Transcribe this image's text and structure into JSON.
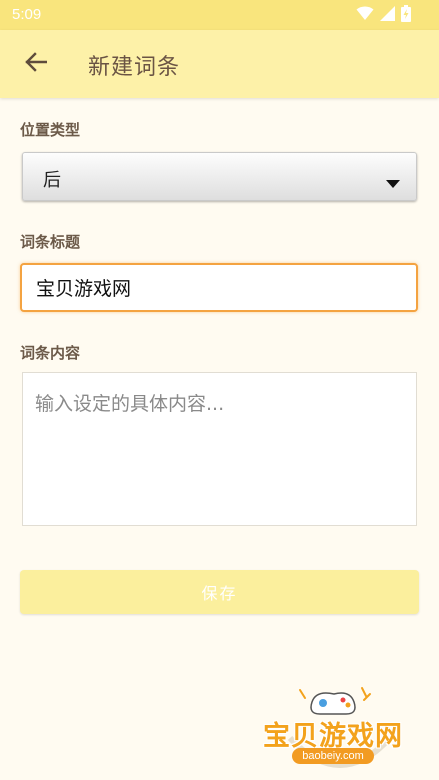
{
  "status_bar": {
    "time": "5:09"
  },
  "header": {
    "title": "新建词条"
  },
  "form": {
    "position_type_label": "位置类型",
    "position_type_value": "后",
    "title_label": "词条标题",
    "title_value": "宝贝游戏网",
    "content_label": "词条内容",
    "content_placeholder": "输入设定的具体内容...",
    "save_label": "保存"
  },
  "watermark": {
    "name": "宝贝游戏网",
    "domain": "baobeiy.com"
  },
  "colors": {
    "status_bar": "#f9e57d",
    "app_bar": "#fdf1a8",
    "background": "#fffbf1",
    "input_focus_border": "#f4a341",
    "save_button": "#fbef9d",
    "label_text": "#6c5a49"
  },
  "icons": {
    "back": "arrow-left-icon",
    "wifi": "wifi-icon",
    "signal": "signal-icon",
    "battery": "battery-charging-icon",
    "dropdown": "caret-down-icon"
  }
}
